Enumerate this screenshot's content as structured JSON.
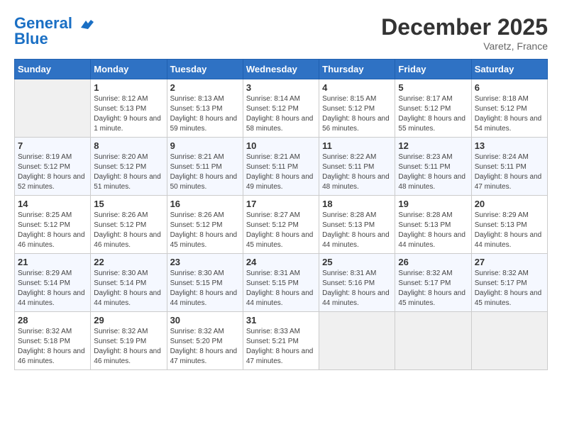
{
  "header": {
    "logo_line1": "General",
    "logo_line2": "Blue",
    "month_title": "December 2025",
    "location": "Varetz, France"
  },
  "weekdays": [
    "Sunday",
    "Monday",
    "Tuesday",
    "Wednesday",
    "Thursday",
    "Friday",
    "Saturday"
  ],
  "weeks": [
    [
      {
        "day": "",
        "empty": true
      },
      {
        "day": "1",
        "sunrise": "8:12 AM",
        "sunset": "5:13 PM",
        "daylight": "9 hours and 1 minute."
      },
      {
        "day": "2",
        "sunrise": "8:13 AM",
        "sunset": "5:13 PM",
        "daylight": "8 hours and 59 minutes."
      },
      {
        "day": "3",
        "sunrise": "8:14 AM",
        "sunset": "5:12 PM",
        "daylight": "8 hours and 58 minutes."
      },
      {
        "day": "4",
        "sunrise": "8:15 AM",
        "sunset": "5:12 PM",
        "daylight": "8 hours and 56 minutes."
      },
      {
        "day": "5",
        "sunrise": "8:17 AM",
        "sunset": "5:12 PM",
        "daylight": "8 hours and 55 minutes."
      },
      {
        "day": "6",
        "sunrise": "8:18 AM",
        "sunset": "5:12 PM",
        "daylight": "8 hours and 54 minutes."
      }
    ],
    [
      {
        "day": "7",
        "sunrise": "8:19 AM",
        "sunset": "5:12 PM",
        "daylight": "8 hours and 52 minutes."
      },
      {
        "day": "8",
        "sunrise": "8:20 AM",
        "sunset": "5:12 PM",
        "daylight": "8 hours and 51 minutes."
      },
      {
        "day": "9",
        "sunrise": "8:21 AM",
        "sunset": "5:11 PM",
        "daylight": "8 hours and 50 minutes."
      },
      {
        "day": "10",
        "sunrise": "8:21 AM",
        "sunset": "5:11 PM",
        "daylight": "8 hours and 49 minutes."
      },
      {
        "day": "11",
        "sunrise": "8:22 AM",
        "sunset": "5:11 PM",
        "daylight": "8 hours and 48 minutes."
      },
      {
        "day": "12",
        "sunrise": "8:23 AM",
        "sunset": "5:11 PM",
        "daylight": "8 hours and 48 minutes."
      },
      {
        "day": "13",
        "sunrise": "8:24 AM",
        "sunset": "5:11 PM",
        "daylight": "8 hours and 47 minutes."
      }
    ],
    [
      {
        "day": "14",
        "sunrise": "8:25 AM",
        "sunset": "5:12 PM",
        "daylight": "8 hours and 46 minutes."
      },
      {
        "day": "15",
        "sunrise": "8:26 AM",
        "sunset": "5:12 PM",
        "daylight": "8 hours and 46 minutes."
      },
      {
        "day": "16",
        "sunrise": "8:26 AM",
        "sunset": "5:12 PM",
        "daylight": "8 hours and 45 minutes."
      },
      {
        "day": "17",
        "sunrise": "8:27 AM",
        "sunset": "5:12 PM",
        "daylight": "8 hours and 45 minutes."
      },
      {
        "day": "18",
        "sunrise": "8:28 AM",
        "sunset": "5:13 PM",
        "daylight": "8 hours and 44 minutes."
      },
      {
        "day": "19",
        "sunrise": "8:28 AM",
        "sunset": "5:13 PM",
        "daylight": "8 hours and 44 minutes."
      },
      {
        "day": "20",
        "sunrise": "8:29 AM",
        "sunset": "5:13 PM",
        "daylight": "8 hours and 44 minutes."
      }
    ],
    [
      {
        "day": "21",
        "sunrise": "8:29 AM",
        "sunset": "5:14 PM",
        "daylight": "8 hours and 44 minutes."
      },
      {
        "day": "22",
        "sunrise": "8:30 AM",
        "sunset": "5:14 PM",
        "daylight": "8 hours and 44 minutes."
      },
      {
        "day": "23",
        "sunrise": "8:30 AM",
        "sunset": "5:15 PM",
        "daylight": "8 hours and 44 minutes."
      },
      {
        "day": "24",
        "sunrise": "8:31 AM",
        "sunset": "5:15 PM",
        "daylight": "8 hours and 44 minutes."
      },
      {
        "day": "25",
        "sunrise": "8:31 AM",
        "sunset": "5:16 PM",
        "daylight": "8 hours and 44 minutes."
      },
      {
        "day": "26",
        "sunrise": "8:32 AM",
        "sunset": "5:17 PM",
        "daylight": "8 hours and 45 minutes."
      },
      {
        "day": "27",
        "sunrise": "8:32 AM",
        "sunset": "5:17 PM",
        "daylight": "8 hours and 45 minutes."
      }
    ],
    [
      {
        "day": "28",
        "sunrise": "8:32 AM",
        "sunset": "5:18 PM",
        "daylight": "8 hours and 46 minutes."
      },
      {
        "day": "29",
        "sunrise": "8:32 AM",
        "sunset": "5:19 PM",
        "daylight": "8 hours and 46 minutes."
      },
      {
        "day": "30",
        "sunrise": "8:32 AM",
        "sunset": "5:20 PM",
        "daylight": "8 hours and 47 minutes."
      },
      {
        "day": "31",
        "sunrise": "8:33 AM",
        "sunset": "5:21 PM",
        "daylight": "8 hours and 47 minutes."
      },
      {
        "day": "",
        "empty": true
      },
      {
        "day": "",
        "empty": true
      },
      {
        "day": "",
        "empty": true
      }
    ]
  ]
}
